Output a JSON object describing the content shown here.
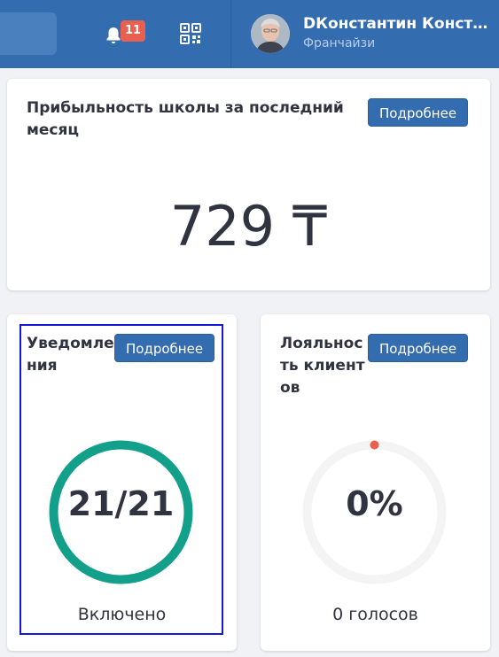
{
  "header": {
    "notifications_count": "11",
    "user_name": "DКонстантин Константинов",
    "user_role": "Франчайзи",
    "colors": {
      "bar": "#346cb0",
      "badge": "#e8604f"
    },
    "icons": [
      "bell-icon",
      "qr-code-icon",
      "avatar"
    ]
  },
  "profit_card": {
    "title": "Прибыльность школы за последний месяц",
    "details_label": "Подробнее",
    "value": "729 ₸"
  },
  "notifications_card": {
    "title": "Уведомления",
    "details_label": "Подробнее",
    "ratio": "21/21",
    "progress": 1.0,
    "status": "Включено",
    "ring_color": "#13a08b"
  },
  "loyalty_card": {
    "title": "Лояльность клиентов",
    "details_label": "Подробнее",
    "percent": "0%",
    "progress": 0,
    "votes": "0 голосов",
    "ring_color": "#f4f4f4",
    "marker_color": "#e8604f"
  }
}
